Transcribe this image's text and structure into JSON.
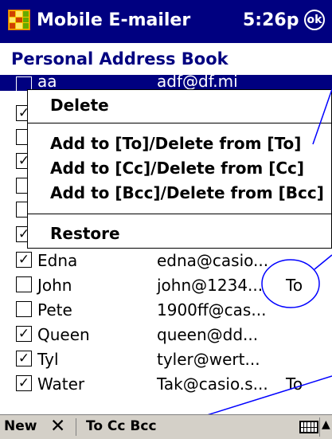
{
  "titlebar": {
    "app_title": "Mobile E-mailer",
    "clock": "5:26p",
    "ok_label": "ok"
  },
  "page": {
    "title": "Personal Address Book"
  },
  "contacts": [
    {
      "name": "aa",
      "email": "adf@df.mi",
      "checked": false,
      "dest": ""
    },
    {
      "name": "",
      "email": "",
      "checked": true,
      "dest": ""
    },
    {
      "name": "",
      "email": "",
      "checked": false,
      "dest": ""
    },
    {
      "name": "",
      "email": "",
      "checked": true,
      "dest": ""
    },
    {
      "name": "",
      "email": "",
      "checked": false,
      "dest": ""
    },
    {
      "name": "",
      "email": "",
      "checked": false,
      "dest": ""
    },
    {
      "name": "",
      "email": "",
      "checked": true,
      "dest": ""
    },
    {
      "name": "Edna",
      "email": "edna@casio...",
      "checked": true,
      "dest": ""
    },
    {
      "name": "John",
      "email": "john@1234...",
      "checked": false,
      "dest": "To"
    },
    {
      "name": "Pete",
      "email": "1900ff@cas...",
      "checked": false,
      "dest": ""
    },
    {
      "name": "Queen",
      "email": "queen@dd...",
      "checked": true,
      "dest": ""
    },
    {
      "name": "Tyl",
      "email": "tyler@wert...",
      "checked": true,
      "dest": ""
    },
    {
      "name": "Water",
      "email": "Tak@casio.s...",
      "checked": true,
      "dest": "To"
    }
  ],
  "context_menu": {
    "delete": "Delete",
    "to": "Add to [To]/Delete from [To]",
    "cc": "Add to [Cc]/Delete from [Cc]",
    "bcc": "Add to [Bcc]/Delete from [Bcc]",
    "restore": "Restore"
  },
  "toolbar": {
    "new_label": "New",
    "close_glyph": "✕",
    "to_cc_bcc": "To Cc Bcc",
    "arrow": "▲"
  },
  "colors": {
    "titlebar": "#000080",
    "selection": "#000080",
    "annotation": "#0000ff"
  }
}
